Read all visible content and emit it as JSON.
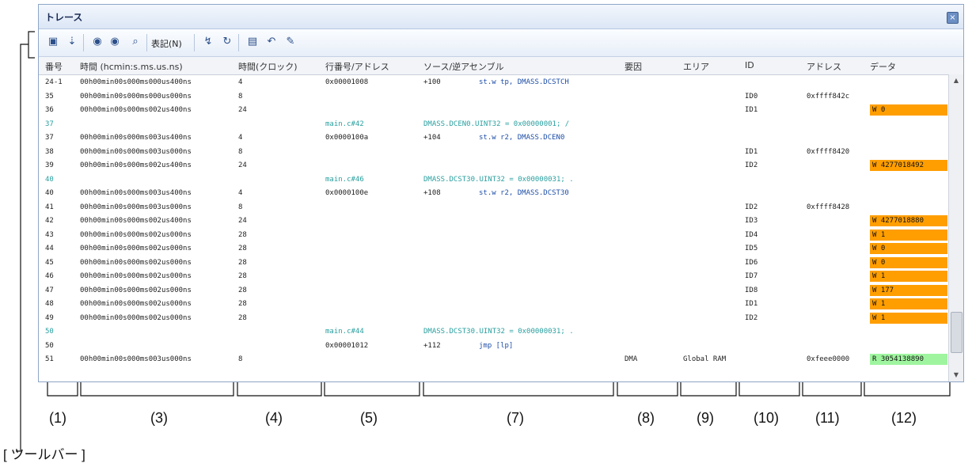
{
  "window": {
    "title": "トレース"
  },
  "toolbar": {
    "buttons": [
      "save-icon",
      "step-icon",
      "forward-icon",
      "back-icon",
      "find-icon"
    ],
    "menu_label": "表記(N)",
    "buttons2": [
      "jump-icon",
      "source-icon",
      "window-icon",
      "undo-icon",
      "edit-icon"
    ]
  },
  "columns": [
    "番号",
    "時間 (hcmin:s.ms.us.ns)",
    "時間(クロック)",
    "行番号/アドレス",
    "ソース/逆アセンブル",
    "要因",
    "エリア",
    "ID",
    "アドレス",
    "データ"
  ],
  "rows": [
    {
      "num": "24-1",
      "time": "00h00min00s000ms000us400ns",
      "clk": "4",
      "addr": "0x00001008",
      "src": "+100",
      "asm": "st.w tp, DMASS.DCSTCH",
      "teal": false
    },
    {
      "num": "35",
      "time": "00h00min00s000ms000us000ns",
      "clk": "8",
      "id": "ID0",
      "adr": "0xffff842c",
      "teal": false
    },
    {
      "num": "36",
      "time": "00h00min00s000ms002us400ns",
      "clk": "24",
      "id": "ID1",
      "data": "W 0",
      "dstyle": "orange",
      "teal": false
    },
    {
      "num": "37",
      "addr": "main.c#42",
      "src": "DMASS.DCEN0.UINT32 = 0x00000001; /",
      "teal": true
    },
    {
      "num": "37",
      "time": "00h00min00s000ms003us400ns",
      "clk": "4",
      "addr": "0x0000100a",
      "src": "+104",
      "asm": "st.w r2, DMASS.DCEN0",
      "teal": false
    },
    {
      "num": "38",
      "time": "00h00min00s000ms003us000ns",
      "clk": "8",
      "id": "ID1",
      "adr": "0xffff8420",
      "teal": false
    },
    {
      "num": "39",
      "time": "00h00min00s000ms002us400ns",
      "clk": "24",
      "id": "ID2",
      "data": "W 4277018492",
      "dstyle": "orange",
      "teal": false
    },
    {
      "num": "40",
      "addr": "main.c#46",
      "src": "DMASS.DCST30.UINT32 = 0x00000031; .",
      "teal": true
    },
    {
      "num": "40",
      "time": "00h00min00s000ms003us400ns",
      "clk": "4",
      "addr": "0x0000100e",
      "src": "+108",
      "asm": "st.w r2, DMASS.DCST30",
      "teal": false
    },
    {
      "num": "41",
      "time": "00h00min00s000ms003us000ns",
      "clk": "8",
      "id": "ID2",
      "adr": "0xffff8428",
      "teal": false
    },
    {
      "num": "42",
      "time": "00h00min00s000ms002us400ns",
      "clk": "24",
      "id": "ID3",
      "data": "W 4277018880",
      "dstyle": "orange",
      "teal": false
    },
    {
      "num": "43",
      "time": "00h00min00s000ms002us000ns",
      "clk": "28",
      "id": "ID4",
      "data": "W 1",
      "dstyle": "orange",
      "teal": false
    },
    {
      "num": "44",
      "time": "00h00min00s000ms002us000ns",
      "clk": "28",
      "id": "ID5",
      "data": "W 0",
      "dstyle": "orange",
      "teal": false
    },
    {
      "num": "45",
      "time": "00h00min00s000ms002us000ns",
      "clk": "28",
      "id": "ID6",
      "data": "W 0",
      "dstyle": "orange",
      "teal": false
    },
    {
      "num": "46",
      "time": "00h00min00s000ms002us000ns",
      "clk": "28",
      "id": "ID7",
      "data": "W 1",
      "dstyle": "orange",
      "teal": false
    },
    {
      "num": "47",
      "time": "00h00min00s000ms002us000ns",
      "clk": "28",
      "id": "ID8",
      "data": "W 177",
      "dstyle": "orange",
      "teal": false
    },
    {
      "num": "48",
      "time": "00h00min00s000ms002us000ns",
      "clk": "28",
      "id": "ID1",
      "data": "W 1",
      "dstyle": "orange",
      "teal": false
    },
    {
      "num": "49",
      "time": "00h00min00s000ms002us000ns",
      "clk": "28",
      "id": "ID2",
      "data": "W 1",
      "dstyle": "orange",
      "teal": false
    },
    {
      "num": "50",
      "addr": "main.c#44",
      "src": "DMASS.DCST30.UINT32 = 0x00000031; .",
      "teal": true
    },
    {
      "num": "50",
      "addr": "0x00001012",
      "src": "+112",
      "asm": "jmp [lp]",
      "teal": false
    },
    {
      "num": "51",
      "time": "00h00min00s000ms003us000ns",
      "clk": "8",
      "cause": "DMA",
      "area": "Global RAM",
      "adr": "0xfeee0000",
      "data": "R 3054138890",
      "dstyle": "green",
      "teal": false
    }
  ],
  "labels": {
    "toolbar": "[ ツールバー ]",
    "c1": "(1)",
    "c3": "(3)",
    "c4": "(4)",
    "c5": "(5)",
    "c7": "(7)",
    "c8": "(8)",
    "c9": "(9)",
    "c10": "(10)",
    "c11": "(11)",
    "c12": "(12)"
  }
}
